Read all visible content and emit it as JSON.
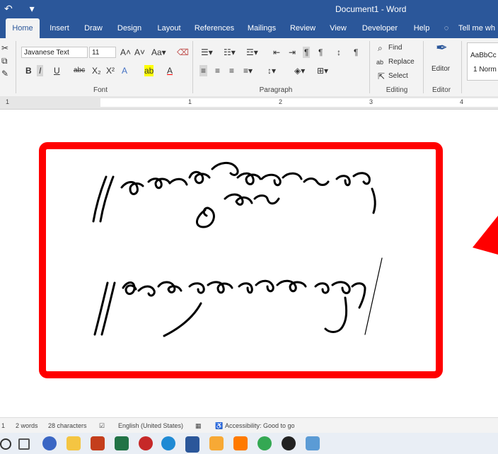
{
  "window": {
    "title": "Document1 - Word"
  },
  "tabs": [
    "Home",
    "Insert",
    "Draw",
    "Design",
    "Layout",
    "References",
    "Mailings",
    "Review",
    "View",
    "Developer",
    "Help"
  ],
  "tell_me": "Tell me wh",
  "font": {
    "name": "Javanese Text",
    "size": "11"
  },
  "groups": {
    "font": "Font",
    "paragraph": "Paragraph",
    "editing": "Editing",
    "editor": "Editor"
  },
  "editing": {
    "find": "Find",
    "replace": "Replace",
    "select": "Select"
  },
  "editor_button": "Editor",
  "styles": {
    "sample": "AaBbCc",
    "name": "1 Norm"
  },
  "ruler": {
    "numbers": [
      "1",
      "1",
      "2",
      "3",
      "4"
    ]
  },
  "status": {
    "words": "2 words",
    "characters": "28 characters",
    "language": "English (United States)",
    "accessibility": "Accessibility: Good to go"
  },
  "colors": {
    "brand": "#2b579a",
    "frame": "#ff0000"
  }
}
